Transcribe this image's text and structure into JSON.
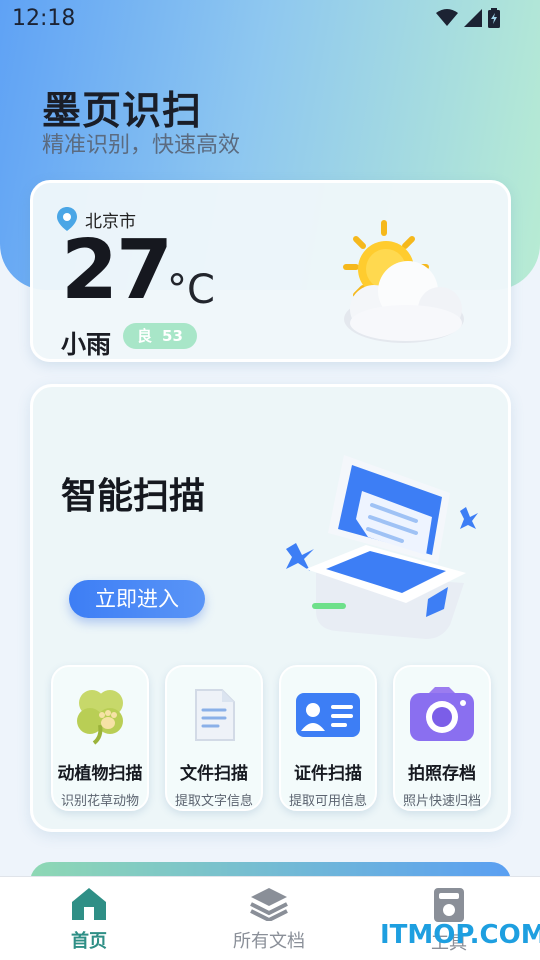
{
  "status_bar": {
    "time": "12:18"
  },
  "header": {
    "title": "墨页识扫",
    "subtitle": "精准识别，快速高效"
  },
  "weather": {
    "city": "北京市",
    "temperature": "27",
    "unit": "°C",
    "condition": "小雨",
    "aqi_level": "良",
    "aqi_value": "53",
    "icon": "sun-cloud-icon"
  },
  "smart_scan": {
    "title": "智能扫描",
    "button_label": "立即进入",
    "illustration": "scanner-icon"
  },
  "features": [
    {
      "label": "动植物扫描",
      "desc": "识别花草动物",
      "icon": "clover-paw-icon"
    },
    {
      "label": "文件扫描",
      "desc": "提取文字信息",
      "icon": "document-icon"
    },
    {
      "label": "证件扫描",
      "desc": "提取可用信息",
      "icon": "id-card-icon"
    },
    {
      "label": "拍照存档",
      "desc": "照片快速归档",
      "icon": "camera-icon"
    }
  ],
  "bottom_nav": [
    {
      "label": "首页",
      "icon": "home-icon",
      "active": true
    },
    {
      "label": "所有文档",
      "icon": "layers-icon",
      "active": false
    },
    {
      "label": "工具",
      "icon": "tool-icon",
      "active": false
    }
  ],
  "watermark": "ITMOP.COM",
  "colors": {
    "accent": "#3d7ef5",
    "nav_active": "#2f8f86",
    "nav_inactive": "#8a8f98",
    "aqi": "#a8e6c8"
  }
}
